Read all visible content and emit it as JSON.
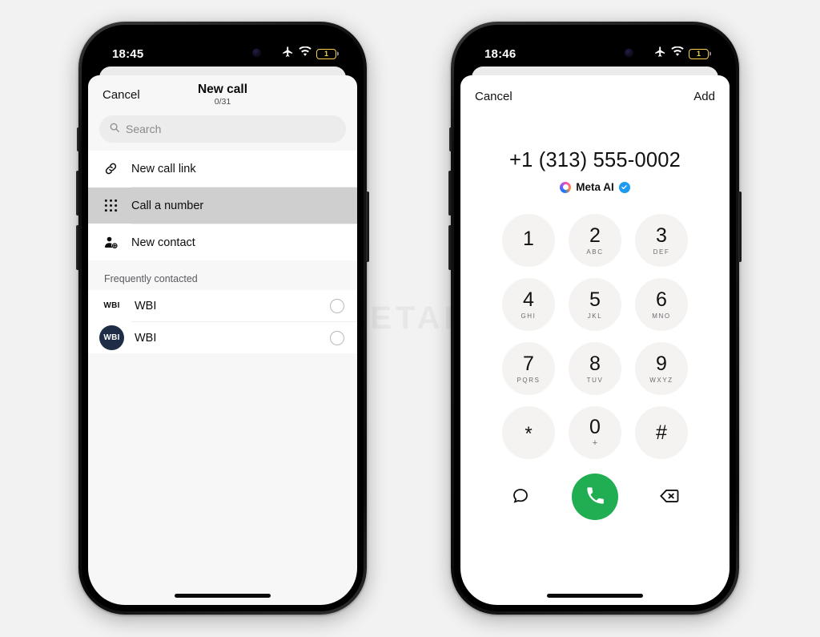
{
  "background_color": "#f2f2f2",
  "phones": [
    {
      "id": "left",
      "status": {
        "time": "18:45",
        "battery_level": "1",
        "icons": [
          "airplane-icon",
          "wifi-icon",
          "battery-icon"
        ]
      },
      "sheet": {
        "cancel_label": "Cancel",
        "title": "New call",
        "counter": "0/31",
        "search_placeholder": "Search",
        "actions": [
          {
            "icon": "link-icon",
            "label": "New call link",
            "selected": false
          },
          {
            "icon": "dialpad-icon",
            "label": "Call a number",
            "selected": true
          },
          {
            "icon": "person-add-icon",
            "label": "New contact",
            "selected": false
          }
        ],
        "section_title": "Frequently contacted",
        "contacts": [
          {
            "name": "WBI",
            "avatar_text": "WBI",
            "avatar_style": "plain",
            "selected": false
          },
          {
            "name": "WBI",
            "avatar_text": "WBI",
            "avatar_style": "navy",
            "selected": false
          }
        ]
      }
    },
    {
      "id": "right",
      "status": {
        "time": "18:46",
        "battery_level": "1",
        "icons": [
          "airplane-icon",
          "wifi-icon",
          "battery-icon"
        ]
      },
      "sheet": {
        "cancel_label": "Cancel",
        "add_label": "Add",
        "number": "+1 (313) 555-0002",
        "meta_name": "Meta AI",
        "verified": true,
        "keys": [
          {
            "digit": "1",
            "sub": ""
          },
          {
            "digit": "2",
            "sub": "ABC"
          },
          {
            "digit": "3",
            "sub": "DEF"
          },
          {
            "digit": "4",
            "sub": "GHI"
          },
          {
            "digit": "5",
            "sub": "JKL"
          },
          {
            "digit": "6",
            "sub": "MNO"
          },
          {
            "digit": "7",
            "sub": "PQRS"
          },
          {
            "digit": "8",
            "sub": "TUV"
          },
          {
            "digit": "9",
            "sub": "WXYZ"
          },
          {
            "digit": "*",
            "sub": ""
          },
          {
            "digit": "0",
            "sub": "+"
          },
          {
            "digit": "#",
            "sub": ""
          }
        ],
        "bottom_actions": [
          "message-icon",
          "call-icon",
          "backspace-icon"
        ],
        "call_button_color": "#21ad52"
      }
    }
  ],
  "watermark": "WABETAINFO"
}
